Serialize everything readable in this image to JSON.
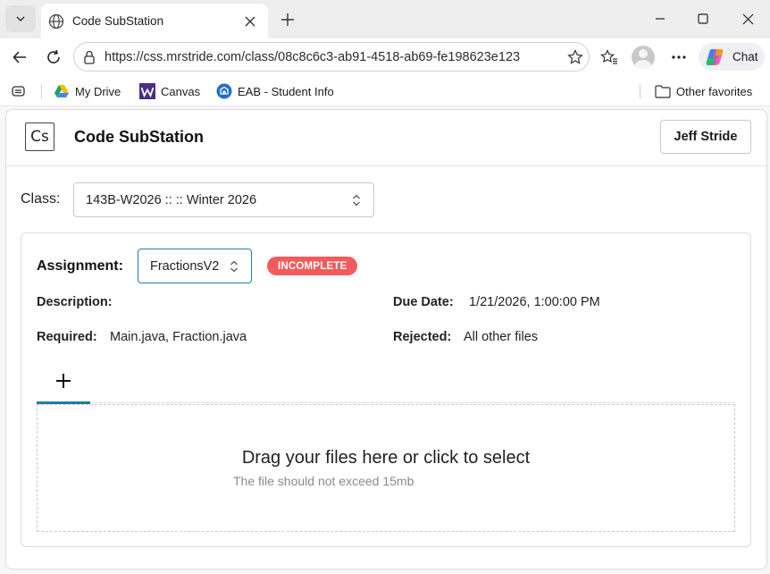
{
  "browser": {
    "tab_title": "Code SubStation",
    "url": "https://css.mrstride.com/class/08c8c6c3-ab91-4518-ab69-fe198623e123",
    "chat_label": "Chat",
    "bookmarks": [
      {
        "label": "My Drive",
        "icon": "google-drive-icon"
      },
      {
        "label": "Canvas",
        "icon": "canvas-w-icon"
      },
      {
        "label": "EAB - Student Info",
        "icon": "eab-icon"
      }
    ],
    "other_favorites": "Other favorites"
  },
  "app": {
    "logo_text": "Cs",
    "title": "Code SubStation",
    "user_button": "Jeff Stride"
  },
  "class_picker": {
    "label": "Class:",
    "selected": "143B-W2026 :: :: Winter 2026"
  },
  "assignment": {
    "label": "Assignment:",
    "selected": "FractionsV2",
    "status": "INCOMPLETE",
    "status_color": "#f25b5b",
    "description_label": "Description:",
    "description_value": "",
    "due_label": "Due Date:",
    "due_value": "1/21/2026, 1:00:00 PM",
    "required_label": "Required:",
    "required_value": "Main.java, Fraction.java",
    "rejected_label": "Rejected:",
    "rejected_value": "All other files"
  },
  "upload": {
    "title": "Drag your files here or click to select",
    "subtitle": "The file should not exceed 15mb"
  },
  "colors": {
    "accent": "#1e7ea1",
    "incomplete": "#f25b5b"
  }
}
